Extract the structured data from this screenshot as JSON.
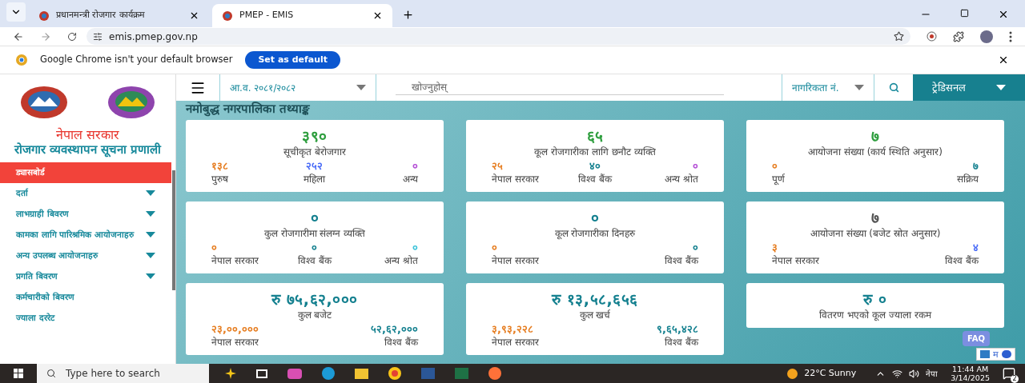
{
  "browser": {
    "tabs": [
      {
        "title": "प्रधानमन्त्री रोजगार कार्यक्रम",
        "selected": false
      },
      {
        "title": "PMEP - EMIS",
        "selected": true
      }
    ],
    "url": "emis.pmep.gov.np",
    "infobar": {
      "message": "Google Chrome isn't your default browser",
      "button": "Set as default"
    }
  },
  "sidebar": {
    "org": "नेपाल सरकार",
    "system": "रोजगार व्यवस्थापन सूचना प्रणाली",
    "items": [
      {
        "label": "ड्यासबोर्ड",
        "kind": "link",
        "selected": true
      },
      {
        "label": "दर्ता",
        "kind": "dropdown",
        "selected": false
      },
      {
        "label": "लाभग्राही बिवरण",
        "kind": "dropdown",
        "selected": false
      },
      {
        "label": "कामका लागि पारिश्रमिक आयोजनाहरु",
        "kind": "dropdown",
        "selected": false
      },
      {
        "label": "अन्य उपलब्ध आयोजनाहरु",
        "kind": "dropdown",
        "selected": false
      },
      {
        "label": "प्रगति बिवरण",
        "kind": "dropdown",
        "selected": false
      },
      {
        "label": "कर्मचारीको बिवरण",
        "kind": "link",
        "selected": false
      },
      {
        "label": "ज्याला दररेट",
        "kind": "link",
        "selected": false
      }
    ]
  },
  "header": {
    "fiscal_year": "आ.व. २०८१/२०८२",
    "search_placeholder": "खोज्नुहोस्",
    "search_by": "नागरिकता नं.",
    "mode": "ट्रेडिसनल"
  },
  "page_title": "नमोबुद्ध नगरपालिका तथ्याङ्क",
  "columns": [
    {
      "cards": [
        {
          "value": "३९०",
          "color": "#2e9e3e",
          "label": "सूचीकृत बेरोजगार",
          "breakdown": [
            {
              "value": "१३८",
              "label": "पुरुष",
              "color": "#e67e22"
            },
            {
              "value": "२५२",
              "label": "महिला",
              "color": "#4a6cf7"
            },
            {
              "value": "०",
              "label": "अन्य",
              "color": "#b44fd6"
            }
          ]
        },
        {
          "value": "०",
          "color": "#14808f",
          "label": "कुल रोजगारीमा संलग्न व्यक्ति",
          "breakdown": [
            {
              "value": "०",
              "label": "नेपाल सरकार",
              "color": "#e67e22"
            },
            {
              "value": "०",
              "label": "विश्व बैंक",
              "color": "#14808f"
            },
            {
              "value": "०",
              "label": "अन्य श्रोत",
              "color": "#3cc3d9"
            }
          ]
        },
        {
          "value": "रु ७५,६२,०००",
          "color": "#14808f",
          "label": "कुल बजेट",
          "breakdown": [
            {
              "value": "२३,००,०००",
              "label": "नेपाल सरकार",
              "color": "#e67e22"
            },
            {
              "value": "५२,६२,०००",
              "label": "विश्व बैंक",
              "color": "#14808f"
            }
          ]
        }
      ]
    },
    {
      "cards": [
        {
          "value": "६५",
          "color": "#2e9e3e",
          "label": "कूल रोजगारीका लागि छनौट व्यक्ति",
          "breakdown": [
            {
              "value": "२५",
              "label": "नेपाल सरकार",
              "color": "#e67e22"
            },
            {
              "value": "४०",
              "label": "विश्व बैंक",
              "color": "#14808f"
            },
            {
              "value": "०",
              "label": "अन्य श्रोत",
              "color": "#b44fd6"
            }
          ]
        },
        {
          "value": "०",
          "color": "#14808f",
          "label": "कूल रोजगारीका दिनहरु",
          "breakdown": [
            {
              "value": "०",
              "label": "नेपाल सरकार",
              "color": "#e67e22"
            },
            {
              "value": "०",
              "label": "विश्व बैंक",
              "color": "#14808f"
            }
          ]
        },
        {
          "value": "रु १३,५८,६५६",
          "color": "#14808f",
          "label": "कुल खर्च",
          "breakdown": [
            {
              "value": "३,९३,२२८",
              "label": "नेपाल सरकार",
              "color": "#e67e22"
            },
            {
              "value": "९,६५,४२८",
              "label": "विश्व बैंक",
              "color": "#14808f"
            }
          ]
        }
      ]
    },
    {
      "cards": [
        {
          "value": "७",
          "color": "#2e9e3e",
          "label": "आयोजना संख्या (कार्य स्थिति अनुसार)",
          "breakdown": [
            {
              "value": "०",
              "label": "पूर्ण",
              "color": "#e67e22"
            },
            {
              "value": "७",
              "label": "सक्रिय",
              "color": "#14808f"
            }
          ]
        },
        {
          "value": "७",
          "color": "#555555",
          "label": "आयोजना संख्या (बजेट स्रोत अनुसार)",
          "breakdown": [
            {
              "value": "३",
              "label": "नेपाल सरकार",
              "color": "#e67e22"
            },
            {
              "value": "४",
              "label": "विश्व बैंक",
              "color": "#4a6cf7"
            }
          ]
        },
        {
          "value": "रु ०",
          "color": "#14808f",
          "label": "वितरण भएको कूल ज्याला रकम"
        }
      ]
    }
  ],
  "faq": "FAQ",
  "ime": {
    "language": "म"
  },
  "taskbar": {
    "search_placeholder": "Type here to search",
    "weather": "22°C Sunny",
    "language": "नेपा",
    "time": "11:44 AM",
    "date": "3/14/2025",
    "notifications": "2"
  }
}
